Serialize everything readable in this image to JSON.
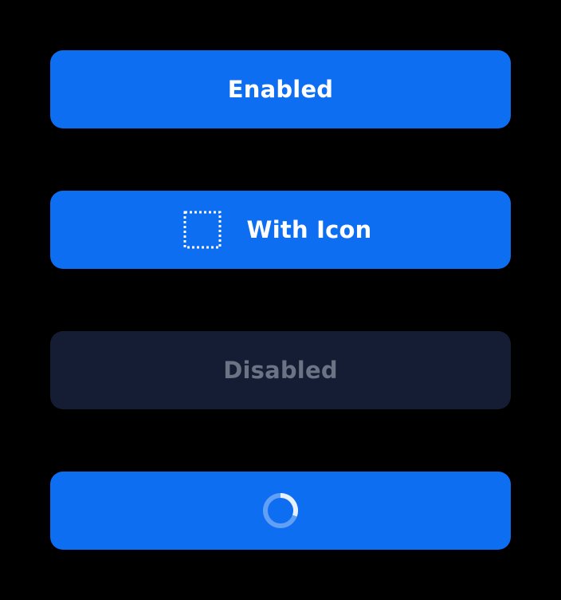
{
  "buttons": {
    "enabled": {
      "label": "Enabled",
      "state": "enabled"
    },
    "with_icon": {
      "label": "With Icon",
      "icon": "placeholder-square-icon",
      "state": "enabled"
    },
    "disabled": {
      "label": "Disabled",
      "state": "disabled"
    },
    "loading": {
      "icon": "spinner-icon",
      "state": "loading"
    }
  },
  "colors": {
    "background": "#000000",
    "primary": "#0d6ef1",
    "primary_text": "#ffffff",
    "disabled_bg": "#141d33",
    "disabled_text": "#6b7385"
  }
}
